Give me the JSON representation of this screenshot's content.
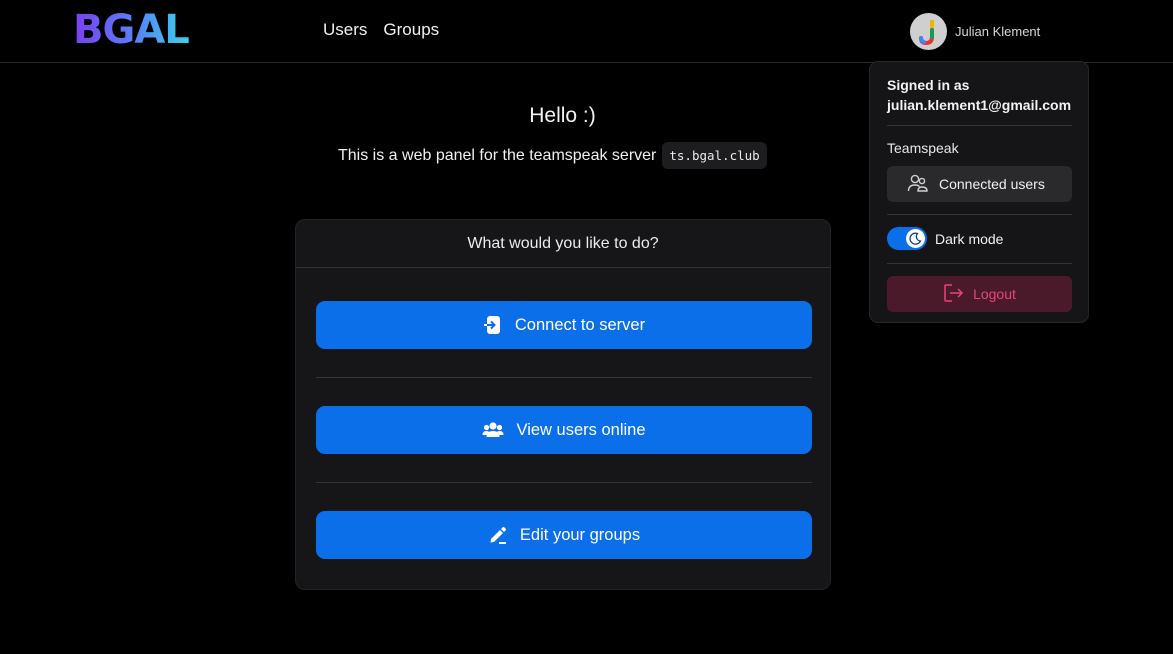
{
  "header": {
    "logo": "BGAL",
    "nav": [
      {
        "label": "Users"
      },
      {
        "label": "Groups"
      }
    ],
    "user_name": "Julian Klement"
  },
  "intro": {
    "hello": "Hello :)",
    "subtitle": "This is a web panel for the teamspeak server",
    "server": "ts.bgal.club"
  },
  "card": {
    "title": "What would you like to do?",
    "actions": [
      {
        "label": "Connect to server",
        "icon": "login-icon"
      },
      {
        "label": "View users online",
        "icon": "users-icon"
      },
      {
        "label": "Edit your groups",
        "icon": "edit-icon"
      }
    ]
  },
  "dropdown": {
    "signed_in_label": "Signed in as",
    "email": "julian.klement1@gmail.com",
    "section_label": "Teamspeak",
    "connected_users": "Connected users",
    "dark_mode": "Dark mode",
    "dark_mode_on": true,
    "logout": "Logout"
  },
  "colors": {
    "accent": "#0a6fe8",
    "logout_text": "#e8457a",
    "logout_bg": "#4a1a2a"
  }
}
